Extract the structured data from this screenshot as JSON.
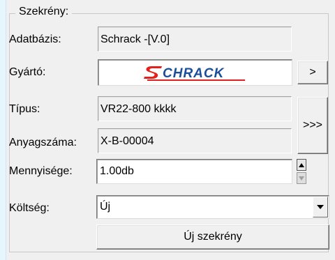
{
  "group": {
    "title": "Szekrény:"
  },
  "labels": {
    "database": "Adatbázis:",
    "manufacturer": "Gyártó:",
    "type": "Típus:",
    "article_number": "Anyagszáma:",
    "quantity": "Mennyisége:",
    "cost": "Költség:"
  },
  "fields": {
    "database": "Schrack -[V.0]",
    "manufacturer_logo": "SCHRACK",
    "type": "VR22-800 kkkk",
    "article_number": "X-B-00004",
    "quantity": "1.00db",
    "cost": "Új"
  },
  "buttons": {
    "manufacturer_more": ">",
    "details": ">>>",
    "new_cabinet": "Új szekrény"
  },
  "colors": {
    "logo_red": "#e4201f",
    "logo_blue": "#1a4e9b",
    "background": "#f0f0f0"
  },
  "icons": {
    "spin_up": "spin-up-icon",
    "spin_down": "spin-down-icon",
    "combo_arrow": "chevron-down-icon"
  }
}
